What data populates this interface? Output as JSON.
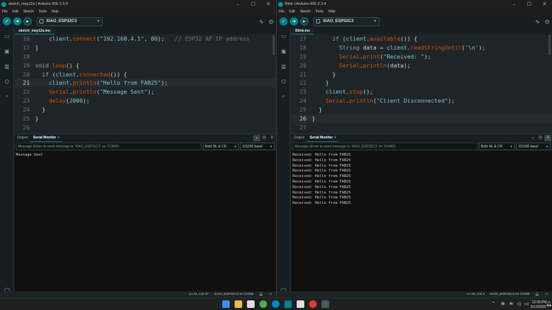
{
  "left": {
    "title": "sketch_may12a | Arduino IDE 2.3.4",
    "menu": [
      "File",
      "Edit",
      "Sketch",
      "Tools",
      "Help"
    ],
    "board": "XIAO_ESP32C3",
    "file_tab": "sketch_may12a.ino",
    "code": [
      {
        "num": "16",
        "html": "    <span class=\"n\">client</span>.<span class=\"f\">connect</span>(<span class=\"s\">\"192.168.4.1\"</span>, <span class=\"n\">80</span>);   <span class=\"c\">// ESP32 AP IP address</span>"
      },
      {
        "num": "17",
        "html": "}"
      },
      {
        "num": "18",
        "html": ""
      },
      {
        "num": "19",
        "html": "<span class=\"k\">void</span> <span class=\"f\">loop</span>() {"
      },
      {
        "num": "20",
        "html": "  <span class=\"k\">if</span> (<span class=\"n\">client</span>.<span class=\"f\">connected</span>()) {"
      },
      {
        "num": "21",
        "html": "    <span class=\"n\">client</span>.<span class=\"f\">println</span>(<span class=\"s\">\"Hello from FAB25\"</span>);",
        "active": true
      },
      {
        "num": "22",
        "html": "    <span class=\"f\">Serial</span>.<span class=\"f\">println</span>(<span class=\"s\">\"Message Sent\"</span>);"
      },
      {
        "num": "23",
        "html": "    <span class=\"f\">delay</span>(<span class=\"n\">2000</span>);"
      },
      {
        "num": "24",
        "html": "  }"
      },
      {
        "num": "25",
        "html": "}"
      },
      {
        "num": "26",
        "html": ""
      }
    ],
    "panel_tabs": [
      "Output",
      "Serial Monitor"
    ],
    "send_placeholder": "Message (Enter to send message to 'XIAO_ESP32C3' on 'COM8')",
    "line_ending": "Both NL & CR",
    "baud": "115200 baud",
    "output": [
      "Message Sent"
    ],
    "status": {
      "position": "Ln 21, Col 37",
      "board_port": "XIAO_ESP32C3 on COM8"
    }
  },
  "right": {
    "title": "Blink | Arduino IDE 2.3.4",
    "menu": [
      "File",
      "Edit",
      "Sketch",
      "Tools",
      "Help"
    ],
    "board": "XIAO_ESP32C3",
    "file_tab": "Blink.ino",
    "code": [
      {
        "num": "17",
        "html": "      <span class=\"k\">if</span> (<span class=\"n\">client</span>.<span class=\"f\">available</span>()) {"
      },
      {
        "num": "18",
        "html": "        <span class=\"k\">String</span> data = <span class=\"n\">client</span>.<span class=\"f\">readStringUntil</span>(<span class=\"s\">'\\n'</span>);"
      },
      {
        "num": "19",
        "html": "        <span class=\"f\">Serial</span>.<span class=\"f\">print</span>(<span class=\"s\">\"Received: \"</span>);"
      },
      {
        "num": "20",
        "html": "        <span class=\"f\">Serial</span>.<span class=\"f\">println</span>(data);"
      },
      {
        "num": "21",
        "html": "      }"
      },
      {
        "num": "22",
        "html": "    }"
      },
      {
        "num": "23",
        "html": "    <span class=\"n\">client</span>.<span class=\"f\">stop</span>();"
      },
      {
        "num": "24",
        "html": "    <span class=\"f\">Serial</span>.<span class=\"f\">println</span>(<span class=\"s\">\"Client Disconnected\"</span>);"
      },
      {
        "num": "25",
        "html": "  }"
      },
      {
        "num": "26",
        "html": "}",
        "active": true
      },
      {
        "num": "27",
        "html": ""
      }
    ],
    "panel_tabs": [
      "Output",
      "Serial Monitor"
    ],
    "send_placeholder": "Message (Enter to send message to 'XIAO_ESP32C3' on 'COM8')",
    "line_ending": "Both NL & CR",
    "baud": "115200 baud",
    "output": [
      "Received: Hello from FAB25",
      "Received: Hello from FAB25",
      "Received: Hello from FAB25",
      "Received: Hello from FAB25",
      "Received: Hello from FAB25",
      "Received: Hello from FAB25",
      "Received: Hello from FAB25",
      "Received: Hello from FAB25",
      "Received: Hello from FAB25",
      "Received: Hello from FAB25"
    ],
    "status": {
      "position": "Ln 26, Col 2",
      "board_port": "XIAO_ESP32C3 on COM6"
    }
  },
  "taskbar": {
    "time": "12:30 PM",
    "date": "5/12/2025"
  }
}
